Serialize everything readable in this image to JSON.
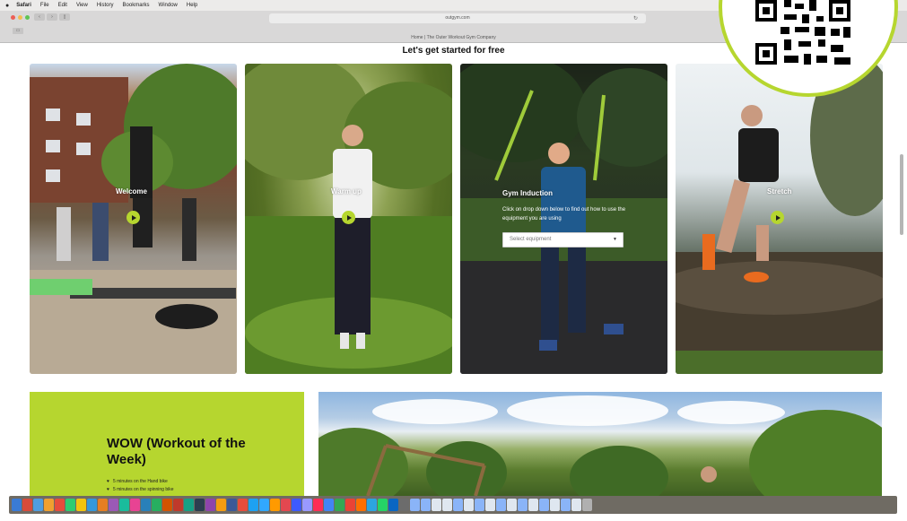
{
  "menubar": {
    "apple": "",
    "items": [
      "Safari",
      "File",
      "Edit",
      "View",
      "History",
      "Bookmarks",
      "Window",
      "Help"
    ]
  },
  "browser": {
    "url": "outgym.com",
    "tab_title": "Home | The Outer Workout Gym Company"
  },
  "page": {
    "heading": "Let's get started for free",
    "cards": [
      {
        "label": "Welcome"
      },
      {
        "label": "Warm up"
      },
      {
        "label": "Gym Induction",
        "text": "Click on drop down below to find out how to use the equipment you are using",
        "select_placeholder": "Select equipment"
      },
      {
        "label": "Stretch"
      }
    ],
    "wow": {
      "title": "WOW (Workout of the Week)",
      "items": [
        "5 minutes on the Hand bike",
        "5 minutes on the spinning bike"
      ]
    }
  },
  "colors": {
    "accent": "#b6d62f"
  },
  "icons": {
    "play": "play-icon",
    "apple": "apple-logo-icon"
  }
}
